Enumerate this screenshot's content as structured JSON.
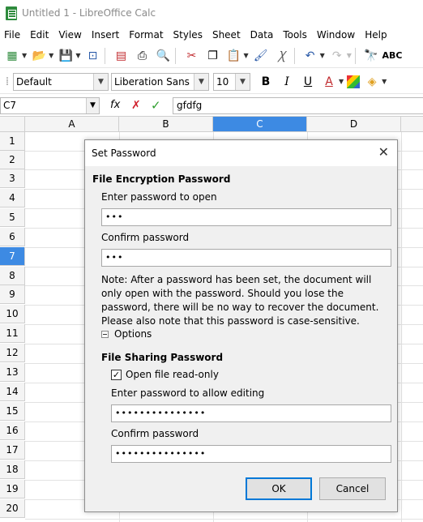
{
  "window": {
    "title": "Untitled 1 - LibreOffice Calc"
  },
  "menu": [
    "File",
    "Edit",
    "View",
    "Insert",
    "Format",
    "Styles",
    "Sheet",
    "Data",
    "Tools",
    "Window",
    "Help"
  ],
  "format_toolbar": {
    "paragraph_style": "Default",
    "font_name": "Liberation Sans",
    "font_size": "10"
  },
  "formula_bar": {
    "cell_ref": "C7",
    "content": "gfdfg"
  },
  "columns": [
    "A",
    "B",
    "C",
    "D"
  ],
  "rows": [
    "1",
    "2",
    "3",
    "4",
    "5",
    "6",
    "7",
    "8",
    "9",
    "10",
    "11",
    "12",
    "13",
    "14",
    "15",
    "16",
    "17",
    "18",
    "19",
    "20"
  ],
  "active_cell": {
    "column": "C",
    "row": "7"
  },
  "dialog": {
    "title": "Set Password",
    "encryption_section": "File Encryption Password",
    "enter_label": "Enter password to open",
    "enter_value": "•••",
    "confirm_label": "Confirm password",
    "confirm_value": "•••",
    "note": "Note: After a password has been set, the document will only open with the password. Should you lose the password, there will be no way to recover the document. Please also note that this password is case-sensitive.",
    "options_label": "Options",
    "sharing_section": "File Sharing Password",
    "readonly_label": "Open file read-only",
    "readonly_checked": true,
    "edit_label": "Enter password to allow editing",
    "edit_value": "•••••••••••••••",
    "edit_confirm_label": "Confirm password",
    "edit_confirm_value": "•••••••••••••••",
    "ok_label": "OK",
    "cancel_label": "Cancel"
  }
}
